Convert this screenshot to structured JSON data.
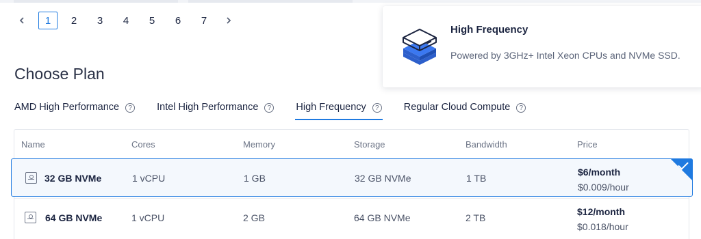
{
  "pagination": {
    "prev_icon": "chevron-left-icon",
    "next_icon": "chevron-right-icon",
    "pages": [
      "1",
      "2",
      "3",
      "4",
      "5",
      "6",
      "7"
    ],
    "active_page": "1"
  },
  "info_card": {
    "icon": "server-stack-icon",
    "title": "High Frequency",
    "description": "Powered by 3GHz+ Intel Xeon CPUs and NVMe SSD."
  },
  "section_title": "Choose Plan",
  "tabs": [
    {
      "label": "AMD High Performance",
      "active": false
    },
    {
      "label": "Intel High Performance",
      "active": false
    },
    {
      "label": "High Frequency",
      "active": true
    },
    {
      "label": "Regular Cloud Compute",
      "active": false
    }
  ],
  "help_glyph": "?",
  "table": {
    "headers": [
      "Name",
      "Cores",
      "Memory",
      "Storage",
      "Bandwidth",
      "Price"
    ],
    "rows": [
      {
        "name": "32 GB NVMe",
        "cores": "1 vCPU",
        "memory": "1 GB",
        "storage": "32 GB NVMe",
        "bandwidth": "1 TB",
        "price_month": "$6/month",
        "price_hour": "$0.009/hour",
        "selected": true
      },
      {
        "name": "64 GB NVMe",
        "cores": "1 vCPU",
        "memory": "2 GB",
        "storage": "64 GB NVMe",
        "bandwidth": "2 TB",
        "price_month": "$12/month",
        "price_hour": "$0.018/hour",
        "selected": false
      }
    ]
  },
  "colors": {
    "accent": "#1f7ae0",
    "text_primary": "#1b2440",
    "text_secondary": "#5a6378"
  }
}
